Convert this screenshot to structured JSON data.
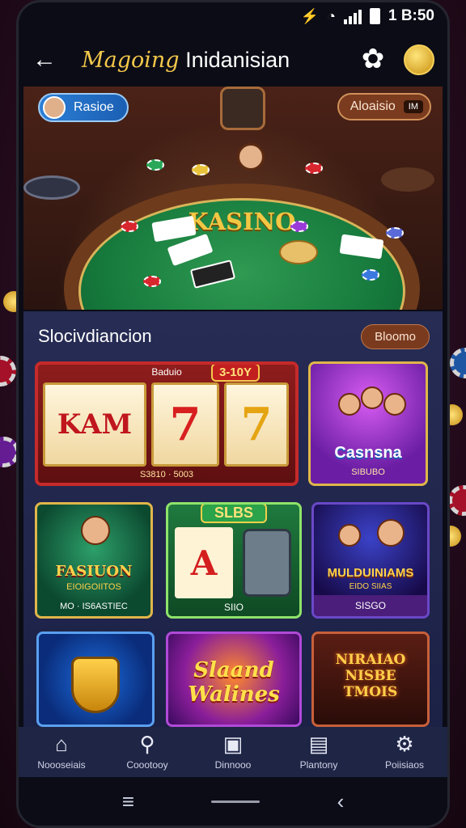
{
  "status": {
    "time": "1 B:50"
  },
  "appbar": {
    "title_gold": "Magoing",
    "title_white": "Inidanisian"
  },
  "hero": {
    "player_name": "Rasioe",
    "balance_label": "Aloaisio",
    "balance_badge": "IM",
    "table_title": "KASINO"
  },
  "section": {
    "title": "Slocivdiancion",
    "button_label": "Bloomo"
  },
  "tiles": {
    "slot": {
      "top_label": "Baduio",
      "badge": "3-10Y",
      "reel1": "KAM",
      "reel2": "7",
      "reel3": "7",
      "footer": "S3810 · 5003"
    },
    "casino": {
      "caption": "Casnsna",
      "sub": "SIBUBO"
    },
    "fashion": {
      "caption": "FASIUON",
      "sub": "EIOIGOIITOS",
      "footer": "MO · IS6ASTIEC"
    },
    "slbs": {
      "badge": "SLBS",
      "card": "A",
      "footer": "SIIO"
    },
    "multi": {
      "caption": "MULDUINIAMS",
      "sub": "EIDO SIIAS",
      "footer": "SISGO"
    },
    "slaand": {
      "caption_line1": "Slaand",
      "caption_line2": "Walines"
    },
    "neon": {
      "line1": "NIRAIAO",
      "line2": "NISBE",
      "line3": "TMOIS"
    }
  },
  "bottom_nav": [
    {
      "label": "Noooseiais",
      "icon": "home-icon"
    },
    {
      "label": "Coootooy",
      "icon": "search-icon"
    },
    {
      "label": "Dinnooo",
      "icon": "box-icon"
    },
    {
      "label": "Plantony",
      "icon": "clipboard-icon"
    },
    {
      "label": "Poiisiaos",
      "icon": "gear-icon"
    }
  ]
}
